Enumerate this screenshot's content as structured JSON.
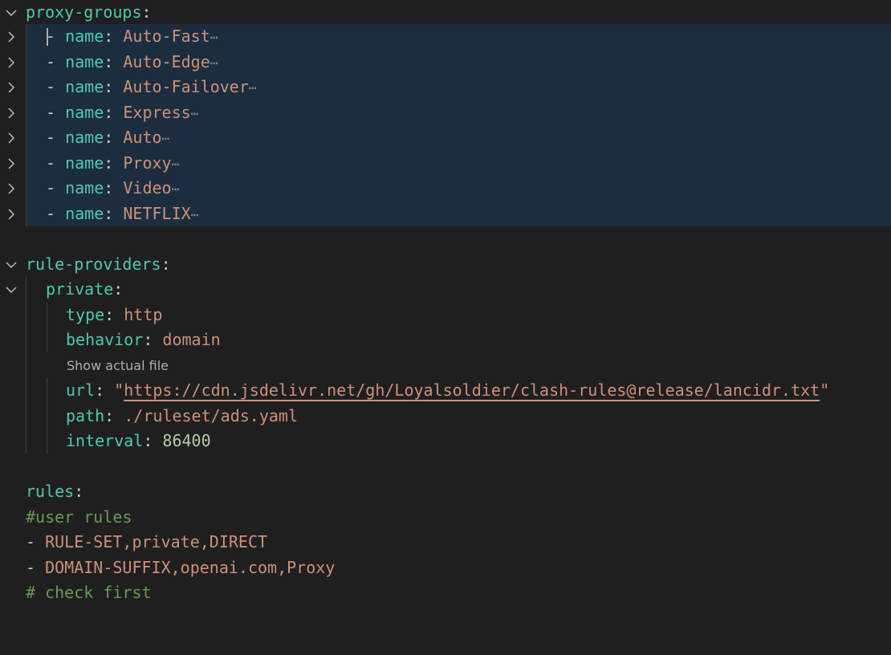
{
  "editor": {
    "proxy_groups_key": "proxy-groups",
    "proxy_groups": [
      {
        "key": "name",
        "value": "Auto-Fast"
      },
      {
        "key": "name",
        "value": "Auto-Edge"
      },
      {
        "key": "name",
        "value": "Auto-Failover"
      },
      {
        "key": "name",
        "value": "Express"
      },
      {
        "key": "name",
        "value": "Auto"
      },
      {
        "key": "name",
        "value": "Proxy"
      },
      {
        "key": "name",
        "value": "Video"
      },
      {
        "key": "name",
        "value": "NETFLIX"
      }
    ],
    "fold_ellipsis": "⋯",
    "rule_providers_key": "rule-providers",
    "provider_name": "private",
    "provider": {
      "type_key": "type",
      "type_value": "http",
      "behavior_key": "behavior",
      "behavior_value": "domain",
      "codelens": "Show actual file",
      "url_key": "url",
      "url_value": "https://cdn.jsdelivr.net/gh/Loyalsoldier/clash-rules@release/lancidr.txt",
      "path_key": "path",
      "path_value": "./ruleset/ads.yaml",
      "interval_key": "interval",
      "interval_value": "86400"
    },
    "rules_key": "rules",
    "rules_comment": "#user rules",
    "rules": [
      "RULE-SET,private,DIRECT",
      "DOMAIN-SUFFIX,openai.com,Proxy"
    ],
    "trailing_comment": "# check first"
  },
  "colors": {
    "background": "#1f1f1f",
    "selection": "#1b2d3f",
    "key": "#4ec9b0",
    "string": "#ce9178",
    "number": "#b5cea8",
    "comment": "#6a9955"
  },
  "icons": {
    "expanded": "chevron-down-icon",
    "collapsed": "chevron-right-icon"
  }
}
